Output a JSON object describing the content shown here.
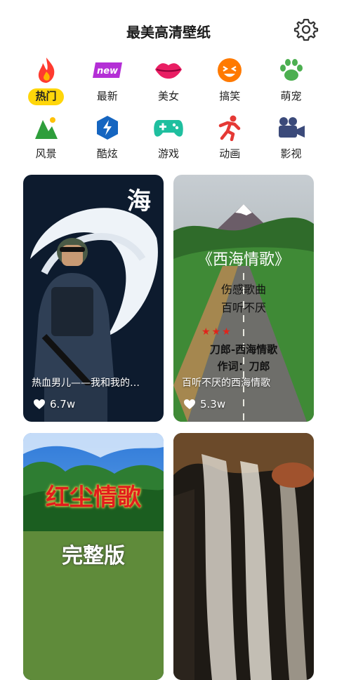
{
  "header": {
    "title": "最美高清壁纸",
    "settings_icon": "gear-icon"
  },
  "categories": [
    {
      "label": "热门",
      "icon": "flame-icon",
      "color": "#ff3b2f",
      "active": true
    },
    {
      "label": "最新",
      "icon": "new-badge-icon",
      "badge_text": "new",
      "color": "#b42fd6"
    },
    {
      "label": "美女",
      "icon": "lips-icon",
      "color": "#e91e63"
    },
    {
      "label": "搞笑",
      "icon": "laughing-face-icon",
      "color": "#ff7a00"
    },
    {
      "label": "萌宠",
      "icon": "paw-icon",
      "color": "#4caf50"
    },
    {
      "label": "风景",
      "icon": "landscape-icon",
      "color": "#2e9e3b"
    },
    {
      "label": "酷炫",
      "icon": "lightning-icon",
      "color": "#1565c0"
    },
    {
      "label": "游戏",
      "icon": "gamepad-icon",
      "color": "#1fbf9f"
    },
    {
      "label": "动画",
      "icon": "running-person-icon",
      "color": "#e53935"
    },
    {
      "label": "影视",
      "icon": "movie-camera-icon",
      "color": "#3b4a7a"
    }
  ],
  "cards": [
    {
      "caption": "热血男儿——我和我的…",
      "likes": "6.7w",
      "poster_text": "海"
    },
    {
      "caption": "百听不厌的西海情歌",
      "likes": "5.3w",
      "poster_title": "《西海情歌》",
      "poster_line1": "伤感歌曲",
      "poster_line2": "百听不厌",
      "poster_line3": "刀郎-西海情歌",
      "poster_line4": "作词：刀郎"
    },
    {
      "poster_title": "红尘情歌",
      "poster_sub": "完整版"
    },
    {}
  ]
}
